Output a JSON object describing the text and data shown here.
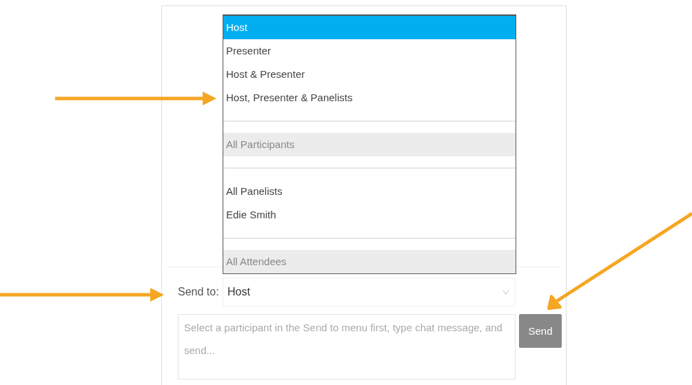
{
  "recipient_menu": {
    "sections": [
      {
        "options": [
          {
            "label": "Host",
            "selected": true
          },
          {
            "label": "Presenter",
            "selected": false
          },
          {
            "label": "Host & Presenter",
            "selected": false
          },
          {
            "label": "Host, Presenter & Panelists",
            "selected": false
          }
        ]
      },
      {
        "header": "All Participants"
      },
      {
        "options": [
          {
            "label": "All Panelists",
            "selected": false
          },
          {
            "label": "Edie Smith",
            "selected": false
          }
        ]
      },
      {
        "header": "All Attendees"
      }
    ]
  },
  "send_to": {
    "label": "Send to:",
    "value": "Host"
  },
  "message": {
    "placeholder": "Select a participant in the Send to menu first, type chat message, and send..."
  },
  "send_button": "Send"
}
